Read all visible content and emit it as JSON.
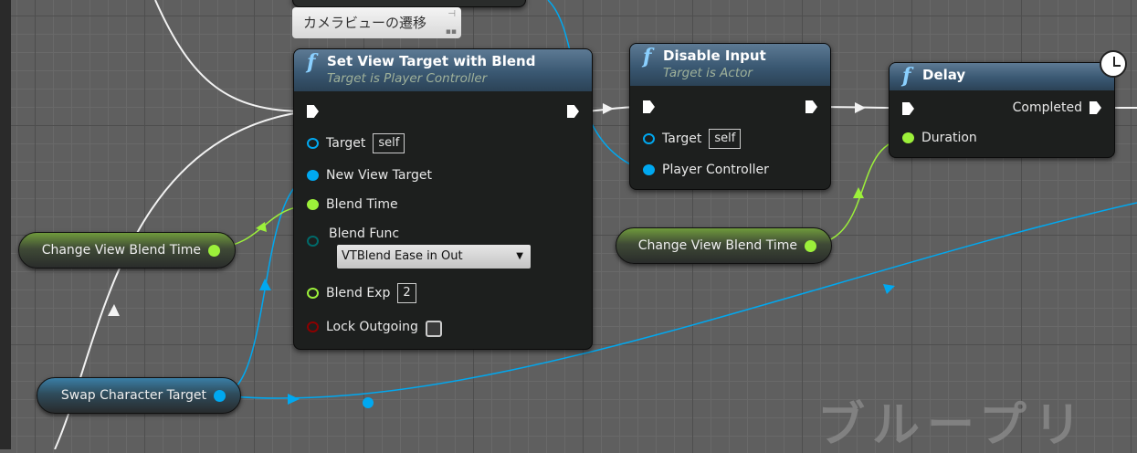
{
  "watermark": "ブループリ",
  "comment": "カメラビューの遷移",
  "set_view_target": {
    "title": "Set View Target with Blend",
    "subtitle": "Target is Player Controller",
    "pins": {
      "target": "Target",
      "target_value": "self",
      "new_view_target": "New View Target",
      "blend_time": "Blend Time",
      "blend_func": "Blend Func",
      "blend_func_value": "VTBlend Ease in Out",
      "blend_exp": "Blend Exp",
      "blend_exp_value": "2",
      "lock_outgoing": "Lock Outgoing"
    }
  },
  "disable_input": {
    "title": "Disable Input",
    "subtitle": "Target is Actor",
    "pins": {
      "target": "Target",
      "target_value": "self",
      "player_controller": "Player Controller"
    }
  },
  "delay": {
    "title": "Delay",
    "completed": "Completed",
    "duration": "Duration"
  },
  "variables": {
    "change_view_blend_time": "Change View Blend Time",
    "swap_character_target": "Swap Character Target"
  },
  "colors": {
    "exec": "#ffffff",
    "object": "#00a8f0",
    "float": "#9cf03a",
    "enum": "#006a6a",
    "bool": "#8c0000"
  }
}
